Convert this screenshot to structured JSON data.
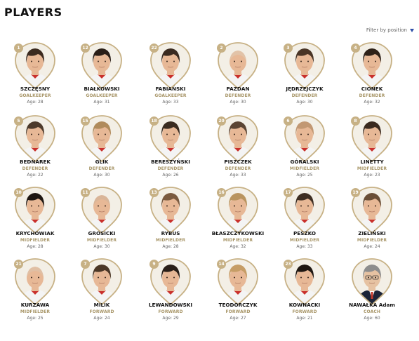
{
  "header": {
    "title": "PLAYERS"
  },
  "filter": {
    "label": "Filter by position"
  },
  "age_prefix": "Age: ",
  "colors": {
    "gold": "#c7b185",
    "position_text": "#a89668",
    "accent": "#2e4fa8"
  },
  "players": [
    {
      "number": "1",
      "name": "SZCZĘSNY",
      "position": "GOALKEEPER",
      "age": "28",
      "hair": "#3b2a1f",
      "coach": false
    },
    {
      "number": "12",
      "name": "BIAŁKOWSKI",
      "position": "GOALKEEPER",
      "age": "31",
      "hair": "#2a1e17",
      "coach": false
    },
    {
      "number": "22",
      "name": "FABIAŃSKI",
      "position": "GOALKEEPER",
      "age": "33",
      "hair": "#3a2a20",
      "coach": false
    },
    {
      "number": "2",
      "name": "PAZDAN",
      "position": "DEFENDER",
      "age": "30",
      "hair": "#e2c3a8",
      "coach": false
    },
    {
      "number": "3",
      "name": "JĘDRZEJCZYK",
      "position": "DEFENDER",
      "age": "30",
      "hair": "#4a3526",
      "coach": false
    },
    {
      "number": "4",
      "name": "CIONEK",
      "position": "DEFENDER",
      "age": "32",
      "hair": "#2e2118",
      "coach": false
    },
    {
      "number": "5",
      "name": "BEDNAREK",
      "position": "DEFENDER",
      "age": "22",
      "hair": "#4d3a2b",
      "coach": false
    },
    {
      "number": "15",
      "name": "GLIK",
      "position": "DEFENDER",
      "age": "30",
      "hair": "#b08b5c",
      "coach": false
    },
    {
      "number": "18",
      "name": "BERESZYŃSKI",
      "position": "DEFENDER",
      "age": "26",
      "hair": "#3a2b20",
      "coach": false
    },
    {
      "number": "20",
      "name": "PISZCZEK",
      "position": "DEFENDER",
      "age": "33",
      "hair": "#5b4433",
      "coach": false
    },
    {
      "number": "6",
      "name": "GÓRALSKI",
      "position": "MIDFIELDER",
      "age": "25",
      "hair": "#c29873",
      "coach": false
    },
    {
      "number": "8",
      "name": "LINETTY",
      "position": "MIDFIELDER",
      "age": "23",
      "hair": "#3a2a1f",
      "coach": false
    },
    {
      "number": "10",
      "name": "KRYCHOWIAK",
      "position": "MIDFIELDER",
      "age": "28",
      "hair": "#1e1611",
      "coach": false
    },
    {
      "number": "11",
      "name": "GROSICKI",
      "position": "MIDFIELDER",
      "age": "30",
      "hair": "#d9b598",
      "coach": false
    },
    {
      "number": "13",
      "name": "RYBUS",
      "position": "MIDFIELDER",
      "age": "28",
      "hair": "#7a5a40",
      "coach": false
    },
    {
      "number": "16",
      "name": "BŁASZCZYKOWSKI",
      "position": "MIDFIELDER",
      "age": "32",
      "hair": "#b9945f",
      "coach": false
    },
    {
      "number": "17",
      "name": "PESZKO",
      "position": "MIDFIELDER",
      "age": "33",
      "hair": "#3e2e22",
      "coach": false
    },
    {
      "number": "19",
      "name": "ZIELIŃSKI",
      "position": "MIDFIELDER",
      "age": "24",
      "hair": "#6a4e37",
      "coach": false
    },
    {
      "number": "21",
      "name": "KURZAWA",
      "position": "MIDFIELDER",
      "age": "25",
      "hair": "#e0bfa4",
      "coach": false
    },
    {
      "number": "7",
      "name": "MILIK",
      "position": "FORWARD",
      "age": "24",
      "hair": "#4b3727",
      "coach": false
    },
    {
      "number": "9",
      "name": "LEWANDOWSKI",
      "position": "FORWARD",
      "age": "29",
      "hair": "#2a1f18",
      "coach": false
    },
    {
      "number": "14",
      "name": "TEODORCZYK",
      "position": "FORWARD",
      "age": "27",
      "hair": "#c69d66",
      "coach": false
    },
    {
      "number": "23",
      "name": "KOWNACKI",
      "position": "FORWARD",
      "age": "21",
      "hair": "#1f1712",
      "coach": false
    },
    {
      "number": "",
      "name": "NAWAŁKA Adam",
      "position": "COACH",
      "age": "60",
      "hair": "#8d8d8d",
      "coach": true
    }
  ]
}
